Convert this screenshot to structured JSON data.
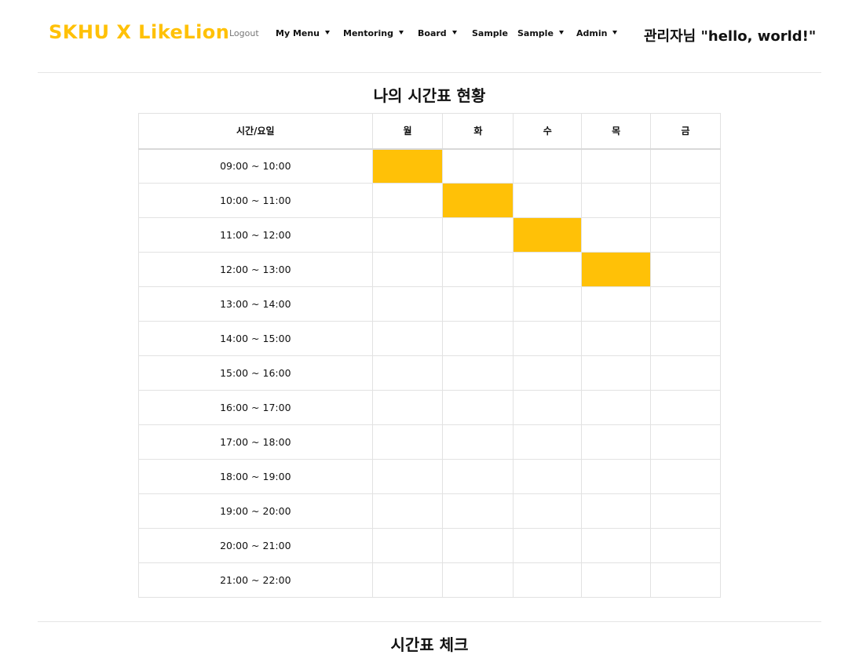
{
  "navbar": {
    "brand": "SKHU X LikeLion",
    "items": [
      {
        "label": "Logout",
        "dropdown": false
      },
      {
        "label": "My Menu",
        "dropdown": true
      },
      {
        "label": "Mentoring",
        "dropdown": true
      },
      {
        "label": "Board",
        "dropdown": true
      },
      {
        "label": "Sample",
        "dropdown": false
      },
      {
        "label": "Sample",
        "dropdown": true
      },
      {
        "label": "Admin",
        "dropdown": true
      }
    ],
    "greeting": "관리자님 \"hello, world!\""
  },
  "timetable": {
    "title": "나의 시간표 현황",
    "header": [
      "시간/요일",
      "월",
      "화",
      "수",
      "목",
      "금"
    ],
    "rows": [
      {
        "time": "09:00 ~ 10:00",
        "filled": [
          true,
          false,
          false,
          false,
          false
        ]
      },
      {
        "time": "10:00 ~ 11:00",
        "filled": [
          false,
          true,
          false,
          false,
          false
        ]
      },
      {
        "time": "11:00 ~ 12:00",
        "filled": [
          false,
          false,
          true,
          false,
          false
        ]
      },
      {
        "time": "12:00 ~ 13:00",
        "filled": [
          false,
          false,
          false,
          true,
          false
        ]
      },
      {
        "time": "13:00 ~ 14:00",
        "filled": [
          false,
          false,
          false,
          false,
          false
        ]
      },
      {
        "time": "14:00 ~ 15:00",
        "filled": [
          false,
          false,
          false,
          false,
          false
        ]
      },
      {
        "time": "15:00 ~ 16:00",
        "filled": [
          false,
          false,
          false,
          false,
          false
        ]
      },
      {
        "time": "16:00 ~ 17:00",
        "filled": [
          false,
          false,
          false,
          false,
          false
        ]
      },
      {
        "time": "17:00 ~ 18:00",
        "filled": [
          false,
          false,
          false,
          false,
          false
        ]
      },
      {
        "time": "18:00 ~ 19:00",
        "filled": [
          false,
          false,
          false,
          false,
          false
        ]
      },
      {
        "time": "19:00 ~ 20:00",
        "filled": [
          false,
          false,
          false,
          false,
          false
        ]
      },
      {
        "time": "20:00 ~ 21:00",
        "filled": [
          false,
          false,
          false,
          false,
          false
        ]
      },
      {
        "time": "21:00 ~ 22:00",
        "filled": [
          false,
          false,
          false,
          false,
          false
        ]
      }
    ],
    "fill_color": "#ffc107"
  },
  "next_section": {
    "title": "시간표 체크"
  },
  "colors": {
    "brand": "#ffc107",
    "text": "#111111",
    "divider": "#e5e5e5"
  }
}
